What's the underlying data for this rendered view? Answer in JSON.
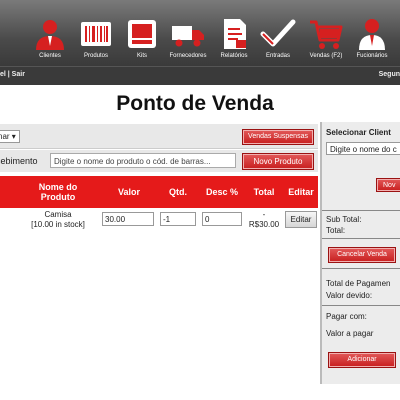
{
  "nav": {
    "items": [
      {
        "label": "Clientes",
        "icon": "clients-icon"
      },
      {
        "label": "Produtos",
        "icon": "barcode-icon"
      },
      {
        "label": "Kits",
        "icon": "box-icon"
      },
      {
        "label": "Fornecedores",
        "icon": "truck-icon"
      },
      {
        "label": "Relatórios",
        "icon": "report-icon"
      },
      {
        "label": "Entradas",
        "icon": "checkmark-icon"
      },
      {
        "label": "Vendas (F2)",
        "icon": "cart-icon"
      },
      {
        "label": "Fucionários",
        "icon": "employee-icon"
      }
    ],
    "accent": "#e51a1a"
  },
  "subbar": {
    "left_text": "el | Sair",
    "right_text": "Segun"
  },
  "page": {
    "title": "Ponto de Venda"
  },
  "controls": {
    "ordenar_value": "nar",
    "vendas_suspensas_label": "Vendas Suspensas",
    "recebimento_label": "cebimento",
    "produto_placeholder": "Digite o nome do produto o cód. de barras...",
    "novo_produto_label": "Novo Produto"
  },
  "table": {
    "headers": [
      "Nome do Produto",
      "Valor",
      "Qtd.",
      "Desc %",
      "Total",
      "Editar"
    ],
    "rows": [
      {
        "name": "Camisa",
        "stock": "[10.00 in stock]",
        "valor": "30.00",
        "qtd": "-1",
        "desc": "0",
        "total_dash": "-",
        "total": "R$30.00",
        "edit_label": "Editar"
      }
    ]
  },
  "right": {
    "title": "Selecionar Client",
    "client_placeholder": "Digite o nome do c",
    "novo_label": "Nov",
    "subtotal_label": "Sub Total:",
    "total_label": "Total:",
    "cancelar_label": "Cancelar Venda",
    "total_pagamento_label": "Total de Pagamen",
    "valor_devido_label": "Valor devido:",
    "pagar_com_label": "Pagar com:",
    "valor_a_pagar_label": "Valor a pagar",
    "adicionar_label": "Adicionar"
  }
}
